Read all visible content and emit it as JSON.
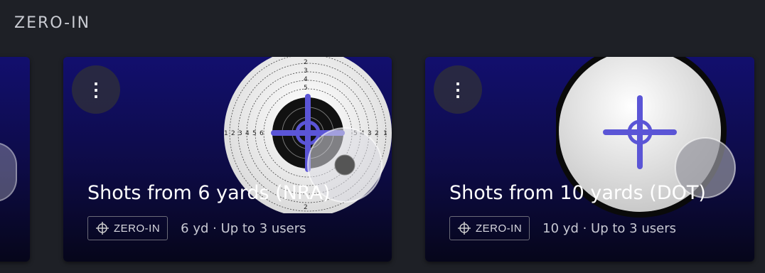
{
  "section": {
    "title": "ZERO-IN"
  },
  "cards": [
    {
      "title": "Shots from 6 yards (NRA)",
      "badge": "ZERO-IN",
      "meta": "6 yd · Up to 3 users",
      "target_type": "nra",
      "ring_numbers": [
        "1",
        "2",
        "3",
        "4",
        "5",
        "6"
      ]
    },
    {
      "title": "Shots from 10 yards (DOT)",
      "badge": "ZERO-IN",
      "meta": "10 yd · Up to 3 users",
      "target_type": "dot"
    }
  ],
  "colors": {
    "accent": "#5b55d6",
    "card_top": "#120f6e",
    "card_bottom": "#06061a"
  }
}
